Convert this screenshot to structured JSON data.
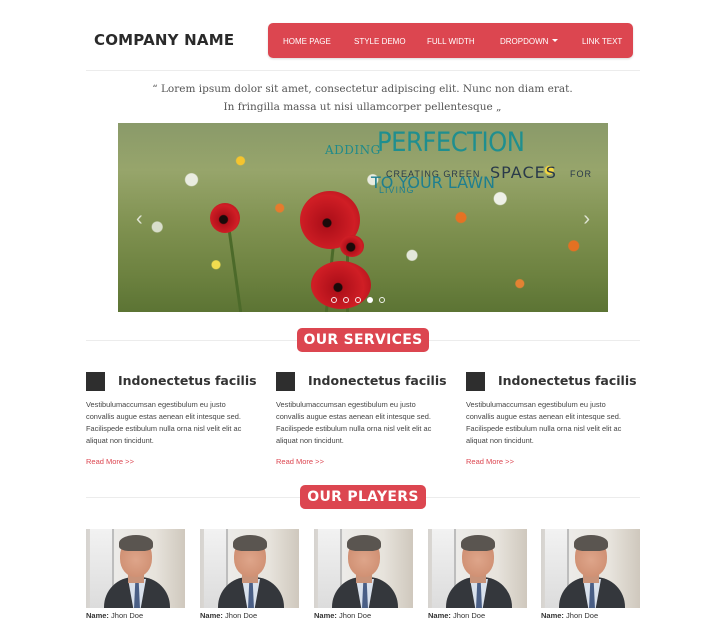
{
  "header": {
    "brand": "COMPANY NAME",
    "nav": [
      {
        "label": "HOME PAGE"
      },
      {
        "label": "STYLE DEMO"
      },
      {
        "label": "FULL WIDTH"
      },
      {
        "label": "DROPDOWN"
      },
      {
        "label": "LINK TEXT"
      }
    ]
  },
  "quote": "“ Lorem ipsum dolor sit amet, consectetur adipiscing elit. Nunc non diam erat. In fringilla massa ut nisi ullamcorper pellentesque „",
  "slider": {
    "overlay": {
      "adding": "ADDING",
      "perfection": "PERFECTION",
      "creating": "CREATING GREEN",
      "spaces": "SPACES",
      "for": "FOR",
      "to_your_lawn": "TO YOUR LAWN",
      "living": "LIVING"
    },
    "prev_icon": "chevron-left-icon",
    "next_icon": "chevron-right-icon",
    "slide_count": 5,
    "active_slide": 4
  },
  "services": {
    "heading": "OUR SERVICES",
    "items": [
      {
        "title": "Indonectetus facilis",
        "text": "Vestibulumaccumsan egestibulum eu justo convallis augue estas aenean elit intesque sed. Facilispede estibulum nulla orna nisl velit elit ac aliquat non tincidunt.",
        "more": "Read More >>"
      },
      {
        "title": "Indonectetus facilis",
        "text": "Vestibulumaccumsan egestibulum eu justo convallis augue estas aenean elit intesque sed. Facilispede estibulum nulla orna nisl velit elit ac aliquat non tincidunt.",
        "more": "Read More >>"
      },
      {
        "title": "Indonectetus facilis",
        "text": "Vestibulumaccumsan egestibulum eu justo convallis augue estas aenean elit intesque sed. Facilispede estibulum nulla orna nisl velit elit ac aliquat non tincidunt.",
        "more": "Read More >>"
      }
    ]
  },
  "players": {
    "heading": "OUR PLAYERS",
    "items": [
      {
        "label": "Name:",
        "name": "Jhon Doe"
      },
      {
        "label": "Name:",
        "name": "Jhon Doe"
      },
      {
        "label": "Name:",
        "name": "Jhon Doe"
      },
      {
        "label": "Name:",
        "name": "Jhon Doe"
      },
      {
        "label": "Name:",
        "name": "Jhon Doe"
      }
    ]
  },
  "colors": {
    "accent": "#dc4650",
    "text": "#333333",
    "icon_square": "#2e2e2e"
  }
}
